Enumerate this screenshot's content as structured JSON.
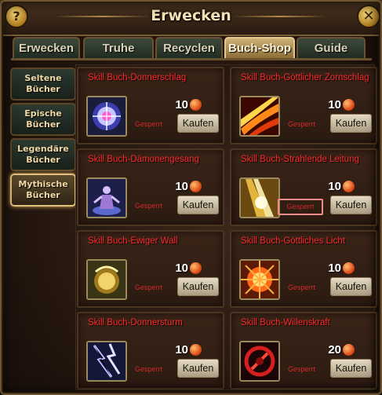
{
  "window": {
    "title": "Erwecken",
    "help_label": "?",
    "close_label": "✕"
  },
  "tabs": [
    {
      "label": "Erwecken",
      "active": false
    },
    {
      "label": "Truhe",
      "active": false
    },
    {
      "label": "Recyclen",
      "active": false
    },
    {
      "label": "Buch-Shop",
      "active": true
    },
    {
      "label": "Guide",
      "active": false
    }
  ],
  "side_nav": [
    {
      "line1": "Seltene",
      "line2": "Bücher",
      "active": false
    },
    {
      "line1": "Epische",
      "line2": "Bücher",
      "active": false
    },
    {
      "line1": "Legendäre",
      "line2": "Bücher",
      "active": false
    },
    {
      "line1": "Mythische",
      "line2": "Bücher",
      "active": true
    }
  ],
  "currency": {
    "icon": "ruby-coin-icon",
    "color": "#e0501a"
  },
  "books": [
    {
      "title": "Skill Buch-Donnerschlag",
      "price": "10",
      "status": "Gesperrt",
      "button": "Kaufen",
      "icon": "thunder-orb-icon"
    },
    {
      "title": "Skill Buch-Göttlicher Zornschlag",
      "price": "10",
      "status": "Gesperrt",
      "button": "Kaufen",
      "icon": "fire-slash-icon"
    },
    {
      "title": "Skill Buch-Dämonengesang",
      "price": "10",
      "status": "Gesperrt",
      "button": "Kaufen",
      "icon": "demon-figure-icon"
    },
    {
      "title": "Skill Buch-Strahlende Leitung",
      "price": "10",
      "status": "Gesperrt",
      "button": "Kaufen",
      "icon": "light-beam-icon"
    },
    {
      "title": "Skill Buch-Ewiger Wall",
      "price": "10",
      "status": "Gesperrt",
      "button": "Kaufen",
      "icon": "golden-shield-icon"
    },
    {
      "title": "Skill Buch-Göttliches Licht",
      "price": "10",
      "status": "Gesperrt",
      "button": "Kaufen",
      "icon": "holy-burst-icon"
    },
    {
      "title": "Skill Buch-Donnersturm",
      "price": "10",
      "status": "Gesperrt",
      "button": "Kaufen",
      "icon": "lightning-storm-icon"
    },
    {
      "title": "Skill Buch-Willenskraft",
      "price": "20",
      "status": "Gesperrt",
      "button": "Kaufen",
      "icon": "red-sigil-icon"
    }
  ]
}
